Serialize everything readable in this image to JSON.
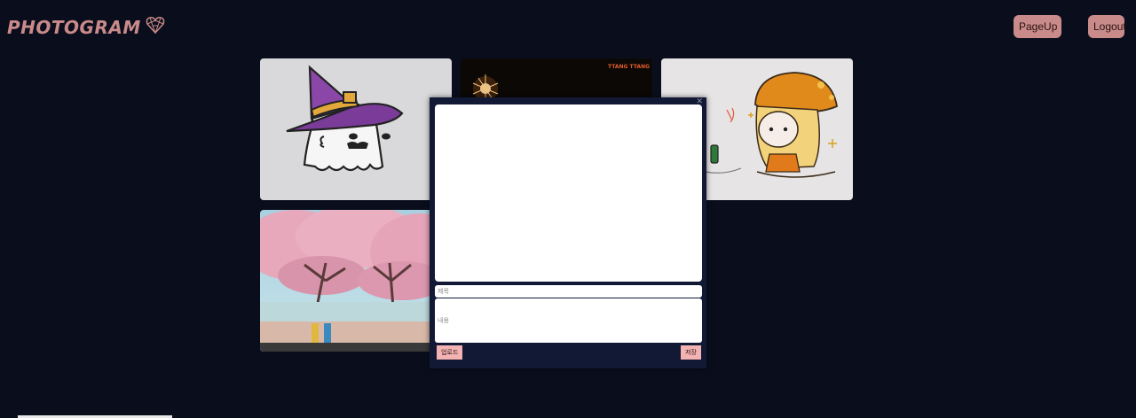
{
  "header": {
    "logo_text": "PHOTOGRAM",
    "logo_icon": "heart-geometric-icon",
    "pageup_label": "PageUp",
    "logout_label": "Logout",
    "accent_color": "#c98a8a"
  },
  "gallery": {
    "items": [
      {
        "subject": "witch-ghost-illustration"
      },
      {
        "subject": "sparkler-night-photo",
        "caption": "TTANG TTANG"
      },
      {
        "subject": "mushroom-hat-girl-illustration"
      },
      {
        "subject": "cherry-blossom-photo"
      }
    ]
  },
  "modal": {
    "close_icon": "close-icon",
    "title_placeholder": "제목",
    "content_placeholder": "내용",
    "upload_label": "업로드",
    "save_label": "저장",
    "button_color": "#f4b3b3",
    "background_color": "#121935"
  }
}
